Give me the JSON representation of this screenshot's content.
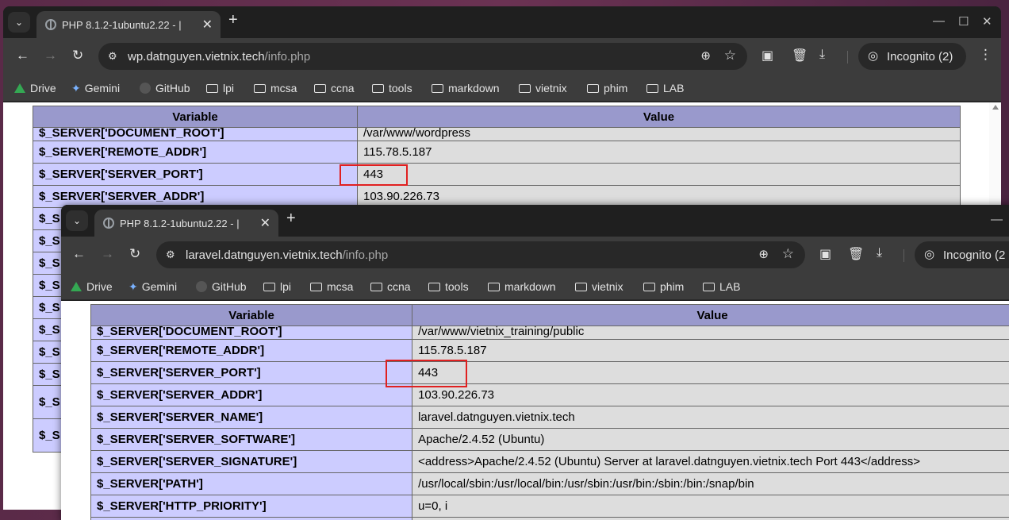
{
  "win1": {
    "tab": {
      "title": "PHP 8.1.2-1ubuntu2.22 - |",
      "close": "✕"
    },
    "new_tab": "+",
    "controls": {
      "minimize": "—",
      "maximize": "☐",
      "close": "✕"
    },
    "url": {
      "host": "wp.datnguyen.vietnix.tech",
      "path": "/info.php"
    },
    "incognito": "Incognito (2)",
    "bookmarks": [
      "Drive",
      "Gemini",
      "GitHub",
      "lpi",
      "mcsa",
      "ccna",
      "tools",
      "markdown",
      "vietnix",
      "phim",
      "LAB"
    ],
    "table": {
      "headers": [
        "Variable",
        "Value"
      ],
      "rows": [
        [
          "$_SERVER['DOCUMENT_ROOT']",
          "/var/www/wordpress"
        ],
        [
          "$_SERVER['REMOTE_ADDR']",
          "115.78.5.187"
        ],
        [
          "$_SERVER['SERVER_PORT']",
          "443"
        ],
        [
          "$_SERVER['SERVER_ADDR']",
          "103.90.226.73"
        ],
        [
          "$_S",
          ""
        ],
        [
          "$_S",
          ""
        ],
        [
          "$_S",
          ""
        ],
        [
          "$_S",
          ""
        ],
        [
          "$_S",
          ""
        ],
        [
          "$_S",
          ""
        ],
        [
          "$_S",
          ""
        ],
        [
          "$_S",
          ""
        ],
        [
          "$_S",
          ""
        ],
        [
          "$_S",
          ""
        ],
        [
          "$_S",
          ""
        ],
        [
          "$_S",
          ""
        ]
      ]
    }
  },
  "win2": {
    "tab": {
      "title": "PHP 8.1.2-1ubuntu2.22 - |",
      "close": "✕"
    },
    "new_tab": "+",
    "controls": {
      "minimize": "—"
    },
    "url": {
      "host": "laravel.datnguyen.vietnix.tech",
      "path": "/info.php"
    },
    "incognito": "Incognito (2",
    "bookmarks": [
      "Drive",
      "Gemini",
      "GitHub",
      "lpi",
      "mcsa",
      "ccna",
      "tools",
      "markdown",
      "vietnix",
      "phim",
      "LAB"
    ],
    "table": {
      "headers": [
        "Variable",
        "Value"
      ],
      "rows": [
        [
          "$_SERVER['DOCUMENT_ROOT']",
          "/var/www/vietnix_training/public"
        ],
        [
          "$_SERVER['REMOTE_ADDR']",
          "115.78.5.187"
        ],
        [
          "$_SERVER['SERVER_PORT']",
          "443"
        ],
        [
          "$_SERVER['SERVER_ADDR']",
          "103.90.226.73"
        ],
        [
          "$_SERVER['SERVER_NAME']",
          "laravel.datnguyen.vietnix.tech"
        ],
        [
          "$_SERVER['SERVER_SOFTWARE']",
          "Apache/2.4.52 (Ubuntu)"
        ],
        [
          "$_SERVER['SERVER_SIGNATURE']",
          "<address>Apache/2.4.52 (Ubuntu) Server at laravel.datnguyen.vietnix.tech Port 443</address>"
        ],
        [
          "$_SERVER['PATH']",
          "/usr/local/sbin:/usr/local/bin:/usr/sbin:/usr/bin:/sbin:/bin:/snap/bin"
        ],
        [
          "$_SERVER['HTTP_PRIORITY']",
          "u=0, i"
        ],
        [
          "",
          ""
        ]
      ]
    }
  }
}
